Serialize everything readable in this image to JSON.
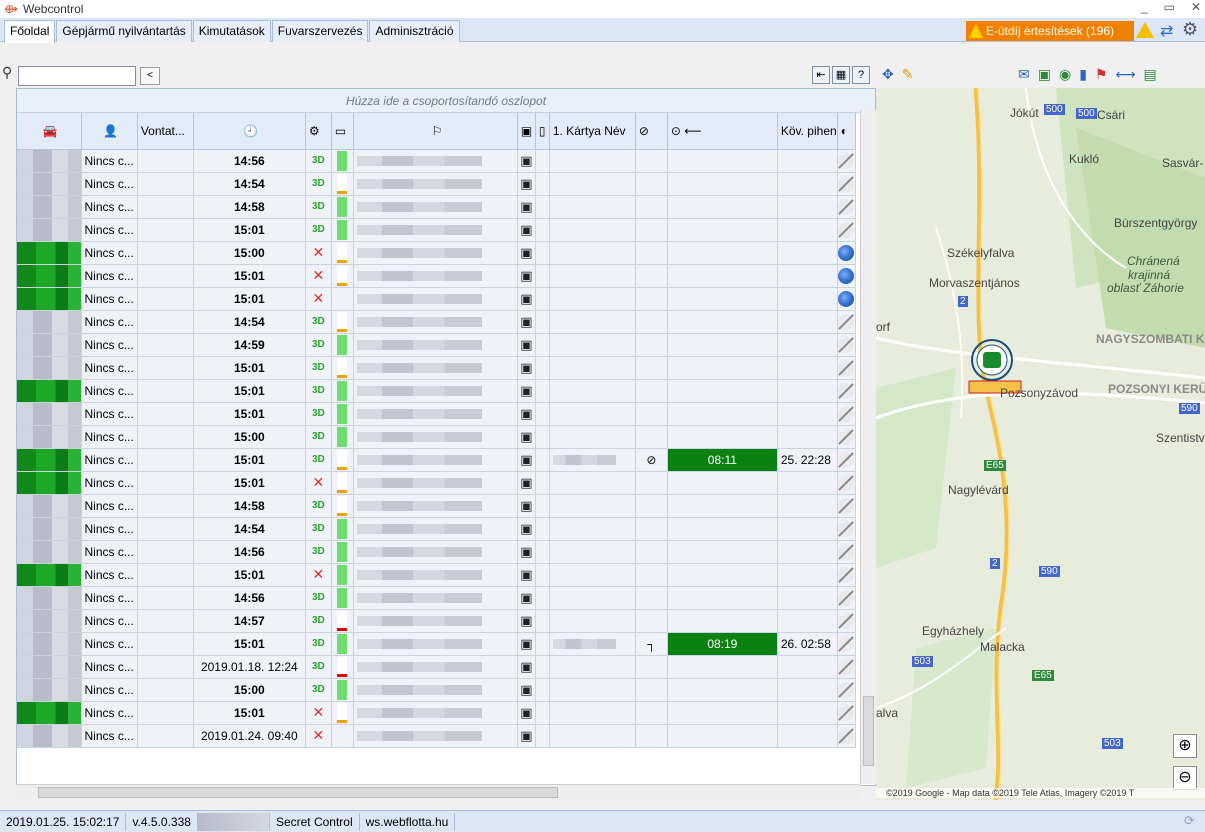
{
  "window": {
    "title": "Webcontrol"
  },
  "tabs": [
    "Főoldal",
    "Gépjármű nyilvántartás",
    "Kimutatások",
    "Fuvarszervezés",
    "Adminisztráció"
  ],
  "notification": {
    "label": "E-útdíj értesítések (196)"
  },
  "grid": {
    "group_hint": "Húzza ide a csoportosítandó oszlopot",
    "headers": {
      "vontat": "Vontat...",
      "card_name": "1. Kártya Név",
      "kov_piheno": "Köv. pihen"
    },
    "rows": [
      {
        "veh": "blur",
        "driver": "Nincs c...",
        "time": "14:56",
        "status": "3D",
        "fuel": "g",
        "card": "",
        "drive": "",
        "next": ""
      },
      {
        "veh": "blur",
        "driver": "Nincs c...",
        "time": "14:54",
        "status": "3D",
        "fuel": "w",
        "card": "",
        "drive": "",
        "next": ""
      },
      {
        "veh": "blur",
        "driver": "Nincs c...",
        "time": "14:58",
        "status": "3D",
        "fuel": "g",
        "card": "",
        "drive": "",
        "next": ""
      },
      {
        "veh": "blur",
        "driver": "Nincs c...",
        "time": "15:01",
        "status": "3D",
        "fuel": "g",
        "card": "",
        "drive": "",
        "next": ""
      },
      {
        "veh": "green",
        "driver": "Nincs c...",
        "time": "15:00",
        "status": "X",
        "fuel": "w",
        "card": "",
        "drive": "",
        "next": "",
        "globe": true
      },
      {
        "veh": "green",
        "driver": "Nincs c...",
        "time": "15:01",
        "status": "X",
        "fuel": "w",
        "card": "",
        "drive": "",
        "next": "",
        "globe": true
      },
      {
        "veh": "green",
        "driver": "Nincs c...",
        "time": "15:01",
        "status": "X",
        "fuel": "",
        "card": "",
        "drive": "",
        "next": "",
        "globe": true
      },
      {
        "veh": "blur",
        "driver": "Nincs c...",
        "time": "14:54",
        "status": "3D",
        "fuel": "w",
        "card": "",
        "drive": "",
        "next": ""
      },
      {
        "veh": "blur",
        "driver": "Nincs c...",
        "time": "14:59",
        "status": "3D",
        "fuel": "g",
        "card": "",
        "drive": "",
        "next": ""
      },
      {
        "veh": "blur",
        "driver": "Nincs c...",
        "time": "15:01",
        "status": "3D",
        "fuel": "w",
        "card": "",
        "drive": "",
        "next": ""
      },
      {
        "veh": "green",
        "driver": "Nincs c...",
        "time": "15:01",
        "status": "3D",
        "fuel": "g",
        "card": "",
        "drive": "",
        "next": ""
      },
      {
        "veh": "blur",
        "driver": "Nincs c...",
        "time": "15:01",
        "status": "3D",
        "fuel": "g",
        "card": "",
        "drive": "",
        "next": ""
      },
      {
        "veh": "blur",
        "driver": "Nincs c...",
        "time": "15:00",
        "status": "3D",
        "fuel": "g",
        "card": "",
        "drive": "",
        "next": ""
      },
      {
        "veh": "green",
        "driver": "Nincs c...",
        "time": "15:01",
        "status": "3D",
        "fuel": "w",
        "card": "blur",
        "drive": "08:11",
        "next": "25. 22:28"
      },
      {
        "veh": "green",
        "driver": "Nincs c...",
        "time": "15:01",
        "status": "X",
        "fuel": "w",
        "card": "",
        "drive": "",
        "next": ""
      },
      {
        "veh": "blur",
        "driver": "Nincs c...",
        "time": "14:58",
        "status": "3D",
        "fuel": "w",
        "card": "",
        "drive": "",
        "next": ""
      },
      {
        "veh": "blur",
        "driver": "Nincs c...",
        "time": "14:54",
        "status": "3D",
        "fuel": "g",
        "card": "",
        "drive": "",
        "next": ""
      },
      {
        "veh": "blur",
        "driver": "Nincs c...",
        "time": "14:56",
        "status": "3D",
        "fuel": "g",
        "card": "",
        "drive": "",
        "next": ""
      },
      {
        "veh": "green",
        "driver": "Nincs c...",
        "time": "15:01",
        "status": "X",
        "fuel": "g",
        "card": "",
        "drive": "",
        "next": ""
      },
      {
        "veh": "blur",
        "driver": "Nincs c...",
        "time": "14:56",
        "status": "3D",
        "fuel": "g",
        "card": "",
        "drive": "",
        "next": ""
      },
      {
        "veh": "blur",
        "driver": "Nincs c...",
        "time": "14:57",
        "status": "3D",
        "fuel": "r",
        "card": "",
        "drive": "",
        "next": ""
      },
      {
        "veh": "blur",
        "driver": "Nincs c...",
        "time": "15:01",
        "status": "3D",
        "fuel": "g",
        "card": "blur",
        "drive": "08:19",
        "next": "26. 02:58"
      },
      {
        "veh": "blur",
        "driver": "Nincs c...",
        "time": "2019.01.18. 12:24",
        "status": "3D",
        "fuel": "r",
        "card": "",
        "drive": "",
        "next": ""
      },
      {
        "veh": "blur",
        "driver": "Nincs c...",
        "time": "15:00",
        "status": "3D",
        "fuel": "g",
        "card": "",
        "drive": "",
        "next": ""
      },
      {
        "veh": "green",
        "driver": "Nincs c...",
        "time": "15:01",
        "status": "X",
        "fuel": "w",
        "card": "",
        "drive": "",
        "next": ""
      },
      {
        "veh": "blur",
        "driver": "Nincs c...",
        "time": "2019.01.24. 09:40",
        "status": "X",
        "fuel": "",
        "card": "",
        "drive": "",
        "next": ""
      }
    ]
  },
  "map": {
    "places": [
      {
        "name": "Jókút",
        "cls": ""
      },
      {
        "name": "Csári",
        "cls": ""
      },
      {
        "name": "Kukló",
        "cls": ""
      },
      {
        "name": "Sasvár-",
        "cls": ""
      },
      {
        "name": "Búrszentgyörgy",
        "cls": ""
      },
      {
        "name": "Székelyfalva",
        "cls": ""
      },
      {
        "name": "Chránená",
        "cls": "italic"
      },
      {
        "name": "krajinná",
        "cls": "italic"
      },
      {
        "name": "oblasť Záhorie",
        "cls": "italic"
      },
      {
        "name": "Morvaszentjános",
        "cls": ""
      },
      {
        "name": "NAGYSZOMBATI KE",
        "cls": ""
      },
      {
        "name": "orf",
        "cls": ""
      },
      {
        "name": "Pozsonyzávod",
        "cls": ""
      },
      {
        "name": "POZSONYI KERÜL",
        "cls": ""
      },
      {
        "name": "Szentistv",
        "cls": ""
      },
      {
        "name": "Nagylévárd",
        "cls": ""
      },
      {
        "name": "Egyházhely",
        "cls": ""
      },
      {
        "name": "Malacka",
        "cls": ""
      },
      {
        "name": "alva",
        "cls": ""
      }
    ],
    "road_labels": [
      "500",
      "500",
      "2",
      "590",
      "E65",
      "2",
      "590",
      "503",
      "E65",
      "503"
    ],
    "copyright": "©2019 Google - Map data ©2019 Tele Atlas, Imagery ©2019 T"
  },
  "statusbar": {
    "datetime": "2019.01.25. 15:02:17",
    "version": "v.4.5.0.338",
    "product": "Secret Control",
    "site": "ws.webflotta.hu"
  }
}
